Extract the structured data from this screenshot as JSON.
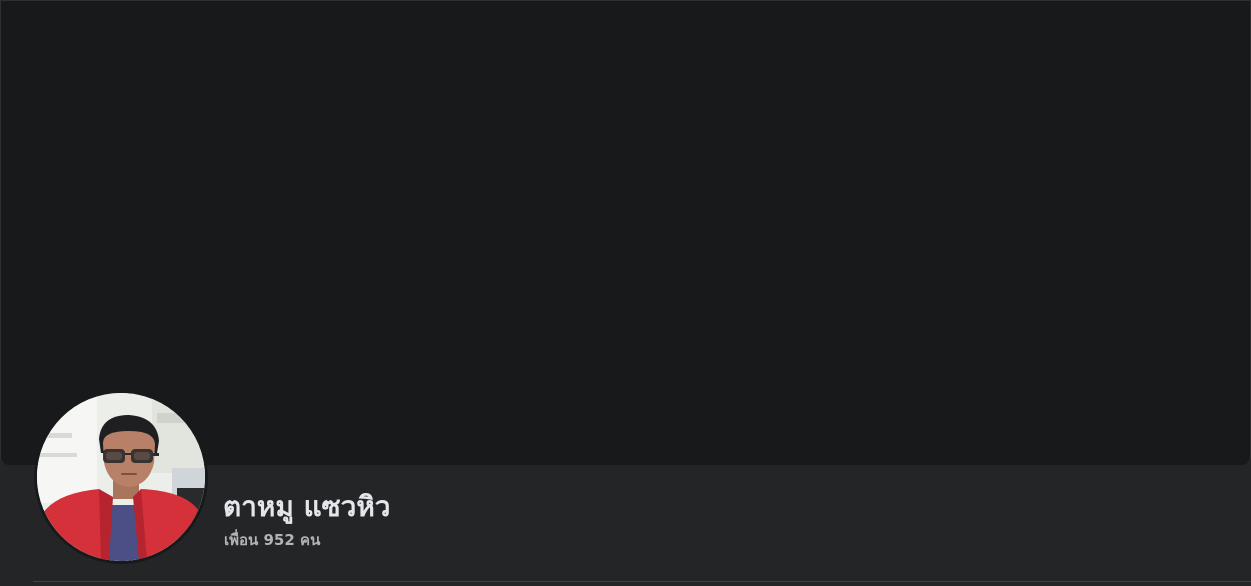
{
  "profile": {
    "name": "ตาหมู แซวหิว",
    "friends_text": "เพื่อน 952 คน"
  },
  "colors": {
    "cover_background": "#18191a",
    "page_background": "#242526",
    "primary_text": "#e4e6eb",
    "secondary_text": "#b0b3b8"
  }
}
